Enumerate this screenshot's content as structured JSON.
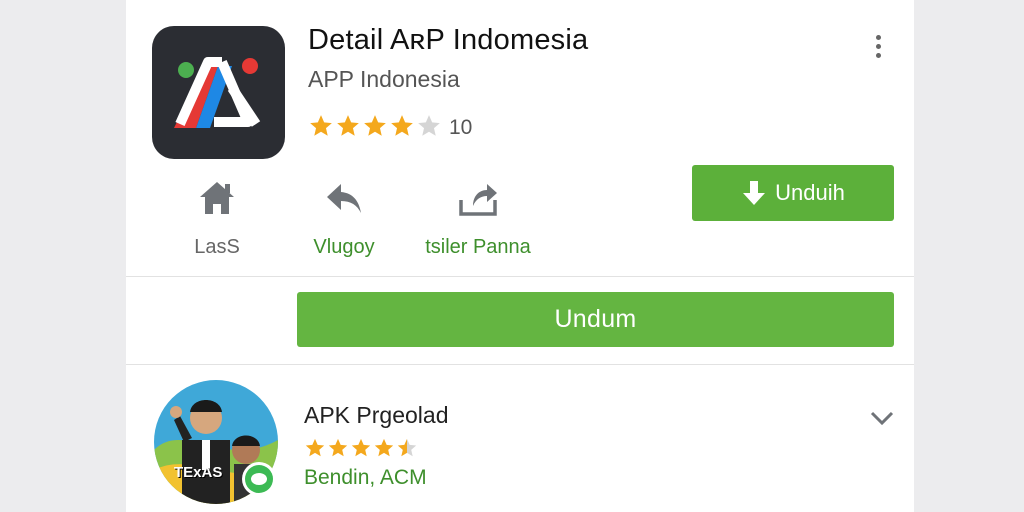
{
  "app": {
    "title": "Detail AʀP Indomesia",
    "developer": "APP Indonesia",
    "rating": 4,
    "rating_max": 5,
    "rating_count": "10",
    "icon_name": "app-logo-icon"
  },
  "actions": [
    {
      "label": "LasS",
      "icon": "home-icon"
    },
    {
      "label": "Vlugoy",
      "icon": "back-arrow-icon"
    },
    {
      "label": "tsiler Panna",
      "icon": "share-icon"
    }
  ],
  "buttons": {
    "install_small": "Unduih",
    "install_large": "Undum"
  },
  "related": {
    "title": "APK Prgeolad",
    "rating": 4.5,
    "subtitle": "Bendin, ACM",
    "avatar_text": "TExAS"
  },
  "colors": {
    "accent_green": "#5cb03a",
    "star": "#f4a81d",
    "star_empty": "#d5d5d5",
    "label_green": "#3e8f2c"
  }
}
